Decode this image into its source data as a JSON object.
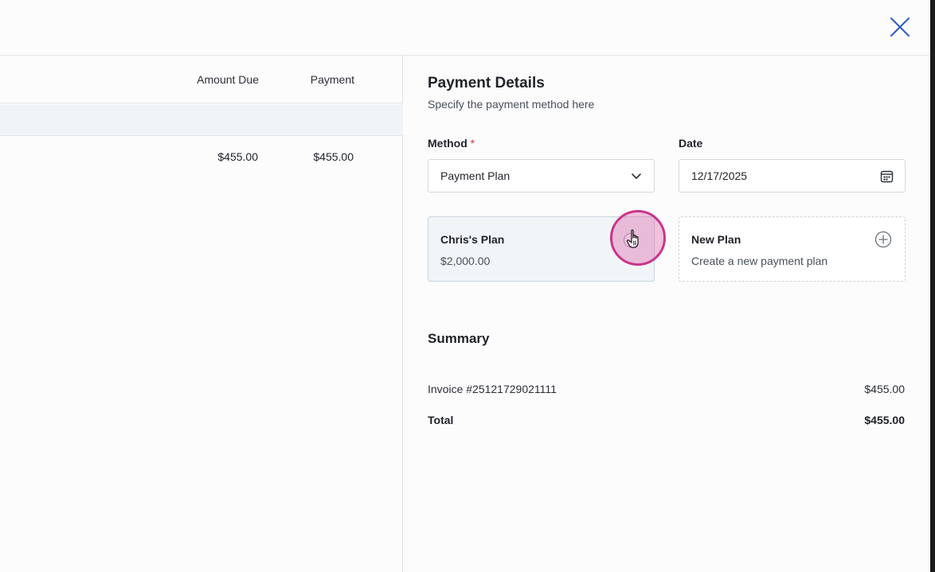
{
  "window": {
    "close_icon": "close-icon"
  },
  "table": {
    "headers": {
      "amount_due": "Amount Due",
      "payment": "Payment"
    },
    "rows": [
      {
        "amount_due": "$455.00",
        "payment": "$455.00"
      }
    ]
  },
  "panel": {
    "title": "Payment Details",
    "subtitle": "Specify the payment method here",
    "method": {
      "label": "Method",
      "required_marker": "*",
      "value": "Payment Plan",
      "icon": "chevron-down-icon"
    },
    "date": {
      "label": "Date",
      "value": "12/17/2025",
      "icon": "calendar-icon"
    },
    "plans": [
      {
        "title": "Chris's Plan",
        "subtitle": "$2,000.00",
        "selected": false
      },
      {
        "title": "New Plan",
        "subtitle": "Create a new payment plan",
        "icon": "plus-circle-icon"
      }
    ]
  },
  "summary": {
    "title": "Summary",
    "invoice_label": "Invoice #25121729021111",
    "invoice_value": "$455.00",
    "total_label": "Total",
    "total_value": "$455.00"
  },
  "colors": {
    "accent": "#2b59c3",
    "cursor_highlight": "#c9358b",
    "required": "#d0343a",
    "card_selected_bg": "#f2f5f8"
  }
}
